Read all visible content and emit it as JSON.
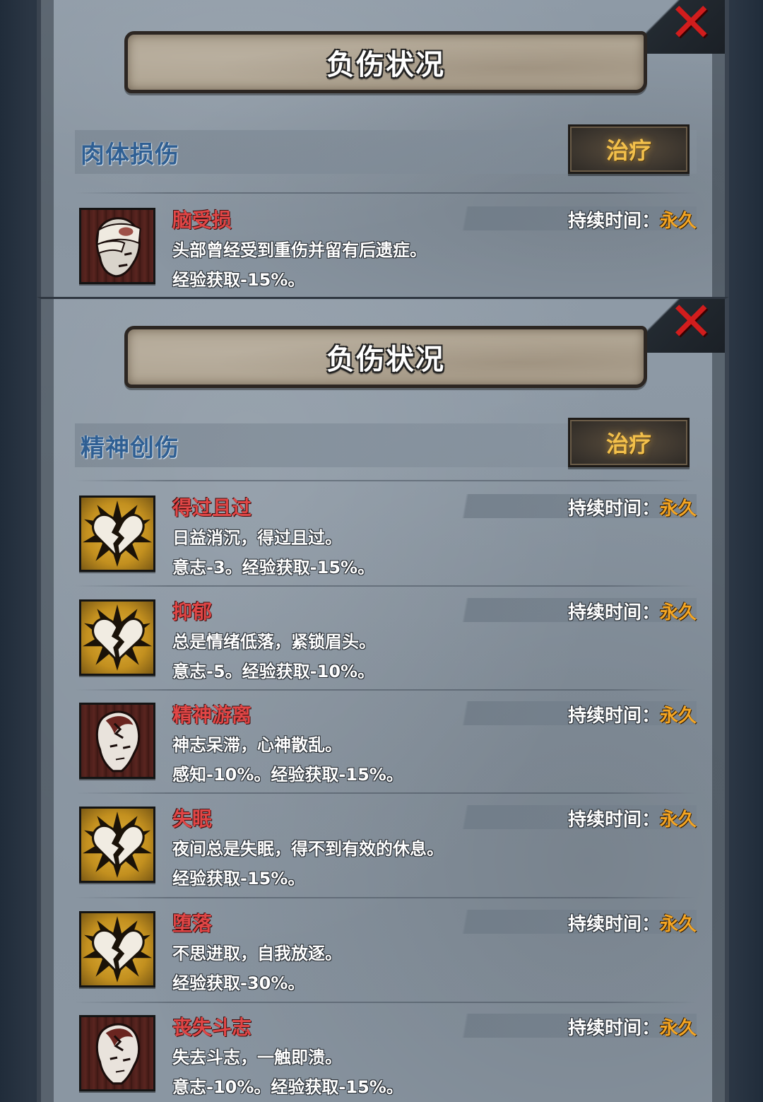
{
  "colors": {
    "title_text": "#ffffff",
    "section_title": "#2f5f93",
    "condition_name": "#e04646",
    "duration_value": "#f5a623",
    "heal_button_text": "#f3c04b",
    "close_x": "#d11d1d"
  },
  "panels": [
    {
      "title": "负伤状况",
      "section_title": "肉体损伤",
      "heal_label": "治疗",
      "close_icon": "close-x-icon",
      "entries": [
        {
          "name": "脑受损",
          "description": "头部曾经受到重伤并留有后遗症。",
          "effect": "经验获取-15%。",
          "duration_label": "持续时间：",
          "duration_value": "永久",
          "icon": "bandaged-head-icon"
        }
      ]
    },
    {
      "title": "负伤状况",
      "section_title": "精神创伤",
      "heal_label": "治疗",
      "close_icon": "close-x-icon",
      "entries": [
        {
          "name": "得过且过",
          "description": "日益消沉，得过且过。",
          "effect": "意志-3。经验获取-15%。",
          "duration_label": "持续时间：",
          "duration_value": "永久",
          "icon": "broken-heart-icon"
        },
        {
          "name": "抑郁",
          "description": "总是情绪低落，紧锁眉头。",
          "effect": "意志-5。经验获取-10%。",
          "duration_label": "持续时间：",
          "duration_value": "永久",
          "icon": "broken-heart-icon"
        },
        {
          "name": "精神游离",
          "description": "神志呆滞，心神散乱。",
          "effect": "感知-10%。经验获取-15%。",
          "duration_label": "持续时间：",
          "duration_value": "永久",
          "icon": "cracked-mind-face-icon"
        },
        {
          "name": "失眠",
          "description": "夜间总是失眠，得不到有效的休息。",
          "effect": "经验获取-15%。",
          "duration_label": "持续时间：",
          "duration_value": "永久",
          "icon": "broken-heart-icon"
        },
        {
          "name": "堕落",
          "description": "不思进取，自我放逐。",
          "effect": "经验获取-30%。",
          "duration_label": "持续时间：",
          "duration_value": "永久",
          "icon": "broken-heart-icon"
        },
        {
          "name": "丧失斗志",
          "description": "失去斗志，一触即溃。",
          "effect": "意志-10%。经验获取-15%。",
          "duration_label": "持续时间：",
          "duration_value": "永久",
          "icon": "cracked-mind-face-icon"
        }
      ]
    }
  ]
}
